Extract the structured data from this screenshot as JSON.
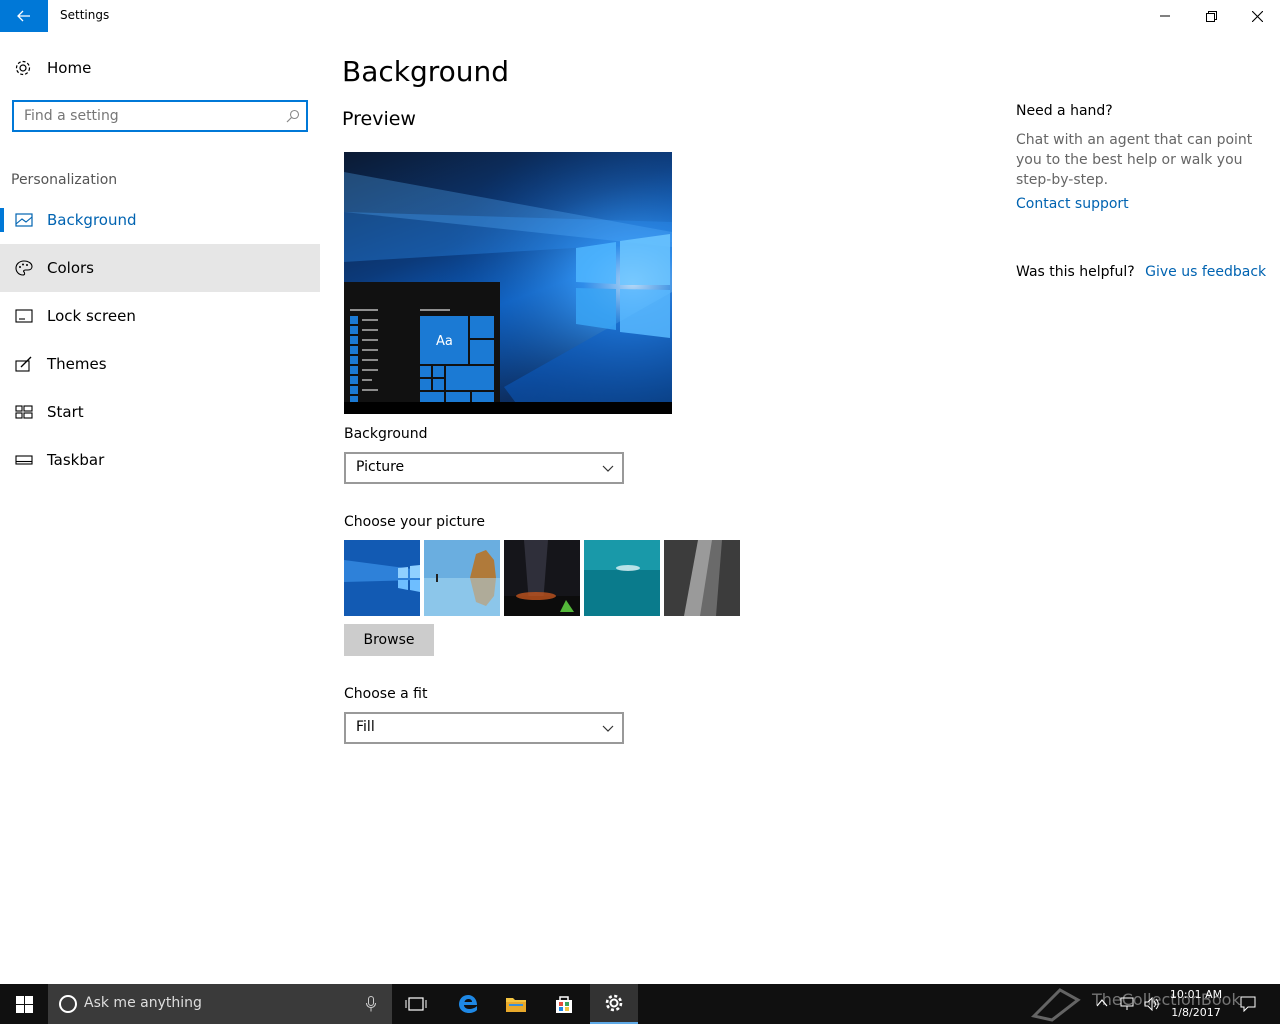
{
  "window": {
    "title": "Settings"
  },
  "sidebar": {
    "home_label": "Home",
    "search_placeholder": "Find a setting",
    "section_label": "Personalization",
    "items": [
      {
        "label": "Background",
        "icon": "picture-icon",
        "state": "selected"
      },
      {
        "label": "Colors",
        "icon": "palette-icon",
        "state": "hover"
      },
      {
        "label": "Lock screen",
        "icon": "lock-screen-icon",
        "state": "normal"
      },
      {
        "label": "Themes",
        "icon": "themes-brush-icon",
        "state": "normal"
      },
      {
        "label": "Start",
        "icon": "start-tiles-icon",
        "state": "normal"
      },
      {
        "label": "Taskbar",
        "icon": "taskbar-icon",
        "state": "normal"
      }
    ]
  },
  "main": {
    "title": "Background",
    "preview_title": "Preview",
    "preview_tile_text": "Aa",
    "background_label": "Background",
    "background_value": "Picture",
    "choose_picture_label": "Choose your picture",
    "browse_label": "Browse",
    "choose_fit_label": "Choose a fit",
    "fit_value": "Fill"
  },
  "help": {
    "title": "Need a hand?",
    "text": "Chat with an agent that can point you to the best help or walk you step-by-step.",
    "contact_link": "Contact support",
    "helpful_label": "Was this helpful?",
    "feedback_link": "Give us feedback"
  },
  "taskbar": {
    "search_placeholder": "Ask me anything",
    "time": "10:01 AM",
    "date": "1/8/2017",
    "watermark": "TheCollectionBook"
  },
  "colors": {
    "accent": "#0078d7",
    "link": "#0063b1",
    "hover_bg": "#e6e6e6",
    "taskbar_bg": "#101010"
  }
}
